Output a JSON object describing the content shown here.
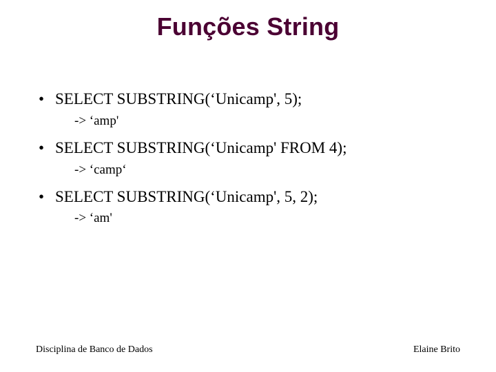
{
  "title": "Funções String",
  "items": [
    {
      "code": "SELECT SUBSTRING(‘Unicamp', 5);",
      "result": "-> ‘amp'"
    },
    {
      "code": "SELECT SUBSTRING(‘Unicamp' FROM 4);",
      "result": "-> ‘camp‘"
    },
    {
      "code": "SELECT SUBSTRING(‘Unicamp', 5, 2);",
      "result": "-> ‘am'"
    }
  ],
  "footer": {
    "left": "Disciplina de Banco de Dados",
    "right": "Elaine Brito"
  }
}
